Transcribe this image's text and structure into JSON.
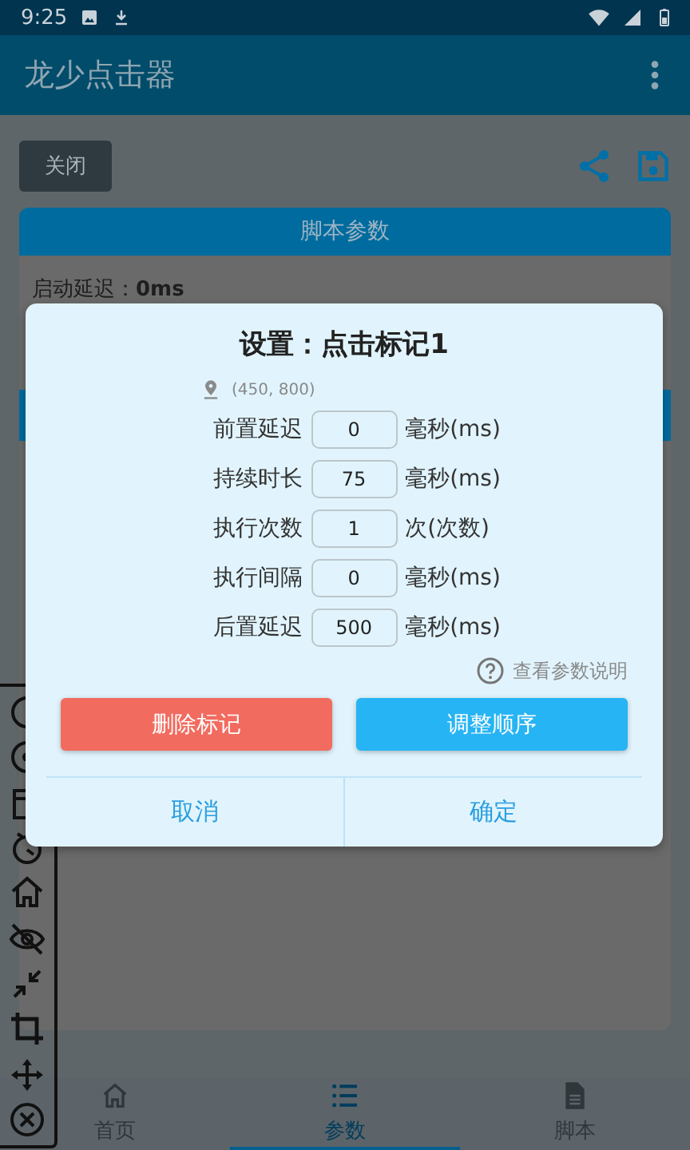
{
  "status_bar": {
    "time": "9:25"
  },
  "app_bar": {
    "title": "龙少点击器"
  },
  "toolbar": {
    "close_button": "关闭"
  },
  "card": {
    "header": "脚本参数",
    "rows": [
      "启动延迟：**0ms**"
    ]
  },
  "dialog": {
    "title": "设置：点击标记1",
    "location": "(450, 800)",
    "fields": [
      {
        "label": "前置延迟",
        "value": "0",
        "unit": "毫秒(ms)"
      },
      {
        "label": "持续时长",
        "value": "75",
        "unit": "毫秒(ms)"
      },
      {
        "label": "执行次数",
        "value": "1",
        "unit": "次(次数)"
      },
      {
        "label": "执行间隔",
        "value": "0",
        "unit": "毫秒(ms)"
      },
      {
        "label": "后置延迟",
        "value": "500",
        "unit": "毫秒(ms)"
      }
    ],
    "help": "查看参数说明",
    "buttons": [
      {
        "label": "删除标记",
        "kind": "danger"
      },
      {
        "label": "调整顺序",
        "kind": "primary"
      }
    ],
    "actions": [
      "取消",
      "确定"
    ]
  },
  "bottom_nav": [
    {
      "label": "首页",
      "selected": false
    },
    {
      "label": "参数",
      "selected": true
    },
    {
      "label": "脚本",
      "selected": false
    }
  ]
}
